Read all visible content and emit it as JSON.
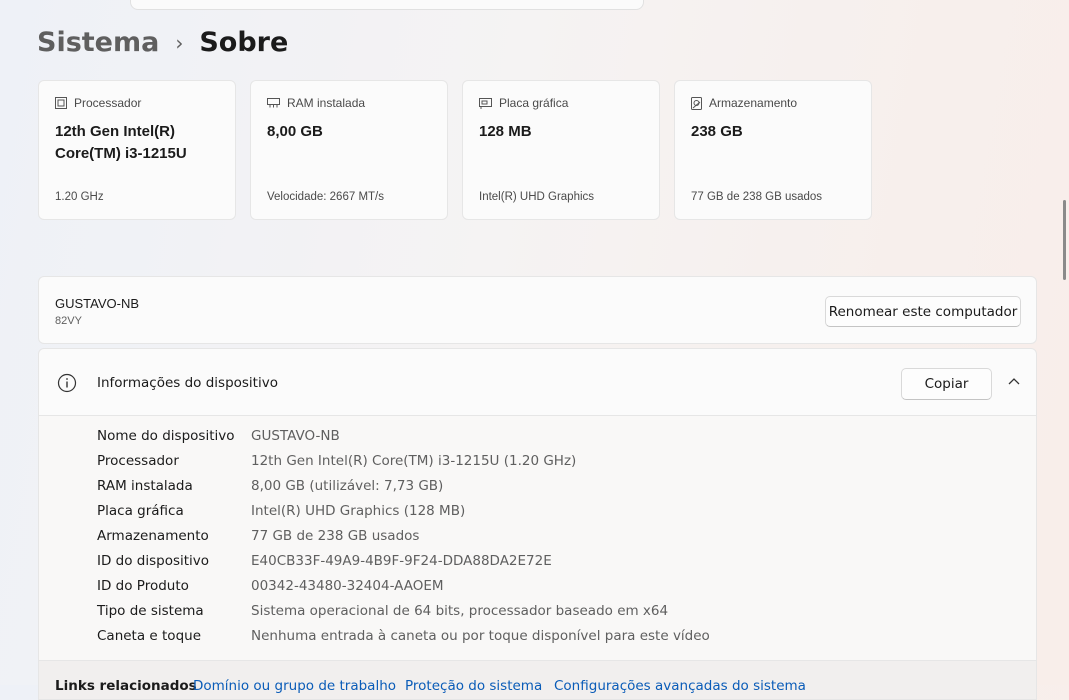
{
  "breadcrumb": {
    "parent": "Sistema",
    "separator": "›",
    "current": "Sobre"
  },
  "cards": [
    {
      "icon": "processor-icon",
      "label": "Processador",
      "value": "12th Gen Intel(R) Core(TM) i3-1215U",
      "sub": "1.20 GHz"
    },
    {
      "icon": "ram-icon",
      "label": "RAM instalada",
      "value": "8,00 GB",
      "sub": "Velocidade: 2667 MT/s"
    },
    {
      "icon": "gpu-icon",
      "label": "Placa gráfica",
      "value": "128 MB",
      "sub": "Intel(R) UHD Graphics"
    },
    {
      "icon": "storage-icon",
      "label": "Armazenamento",
      "value": "238 GB",
      "sub": "77 GB de 238 GB usados"
    }
  ],
  "device": {
    "name": "GUSTAVO-NB",
    "model": "82VY",
    "rename_label": "Renomear este computador"
  },
  "info": {
    "title": "Informações do dispositivo",
    "copy_label": "Copiar",
    "rows": [
      {
        "key": "Nome do dispositivo",
        "value": "GUSTAVO-NB"
      },
      {
        "key": "Processador",
        "value": "12th Gen Intel(R) Core(TM) i3-1215U (1.20 GHz)"
      },
      {
        "key": "RAM instalada",
        "value": "8,00 GB (utilizável: 7,73 GB)"
      },
      {
        "key": "Placa gráfica",
        "value": "Intel(R) UHD Graphics (128 MB)"
      },
      {
        "key": "Armazenamento",
        "value": "77 GB de 238 GB usados"
      },
      {
        "key": "ID do dispositivo",
        "value": "E40CB33F-49A9-4B9F-9F24-DDA88DA2E72E"
      },
      {
        "key": "ID do Produto",
        "value": "00342-43480-32404-AAOEM"
      },
      {
        "key": "Tipo de sistema",
        "value": "Sistema operacional de 64 bits, processador baseado em x64"
      },
      {
        "key": "Caneta e toque",
        "value": "Nenhuma entrada à caneta ou por toque disponível para este vídeo"
      }
    ]
  },
  "related": {
    "label": "Links relacionados",
    "links": [
      "Domínio ou grupo de trabalho",
      "Proteção do sistema",
      "Configurações avançadas do sistema"
    ]
  },
  "colors": {
    "link": "#0a5cb8",
    "card_bg": "#fbfbfb",
    "muted_text": "#5f5f5f"
  }
}
